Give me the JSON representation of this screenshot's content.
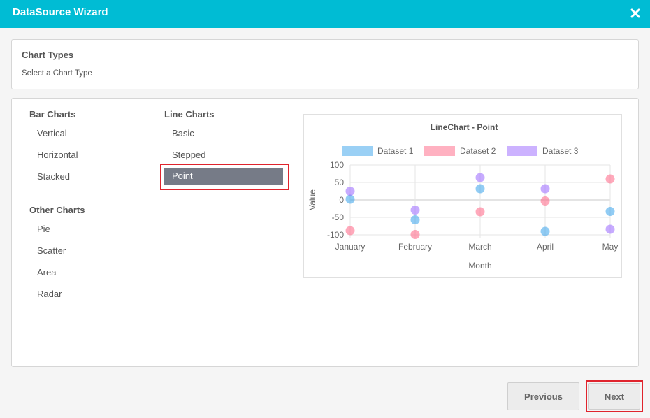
{
  "window": {
    "title": "DataSource Wizard"
  },
  "header": {
    "title": "Chart Types",
    "subtitle": "Select a Chart Type"
  },
  "groups": {
    "bar": {
      "label": "Bar Charts",
      "items": [
        "Vertical",
        "Horizontal",
        "Stacked"
      ]
    },
    "other": {
      "label": "Other Charts",
      "items": [
        "Pie",
        "Scatter",
        "Area",
        "Radar"
      ]
    },
    "line": {
      "label": "Line Charts",
      "items": [
        "Basic",
        "Stepped",
        "Point"
      ],
      "selected": "Point"
    }
  },
  "buttons": {
    "previous": "Previous",
    "next": "Next"
  },
  "colors": {
    "accent": "#00bcd4",
    "selected_bg": "#767b87",
    "highlight": "#e0242d"
  },
  "icons": {
    "close": "close-icon"
  },
  "chart_data": {
    "type": "scatter",
    "title": "LineChart - Point",
    "xlabel": "Month",
    "ylabel": "Value",
    "categories": [
      "January",
      "February",
      "March",
      "April",
      "May"
    ],
    "ylim": [
      -100,
      100
    ],
    "yticks": [
      100,
      50,
      0,
      -50,
      -100
    ],
    "grid": true,
    "legend_position": "top",
    "series": [
      {
        "name": "Dataset 1",
        "color": "#36a2eb",
        "values": [
          2,
          -57,
          32,
          -90,
          -33
        ]
      },
      {
        "name": "Dataset 2",
        "color": "#ff6384",
        "values": [
          -88,
          -99,
          -34,
          -3,
          60
        ]
      },
      {
        "name": "Dataset 3",
        "color": "#9966ff",
        "values": [
          25,
          -29,
          64,
          32,
          -84
        ]
      }
    ]
  }
}
